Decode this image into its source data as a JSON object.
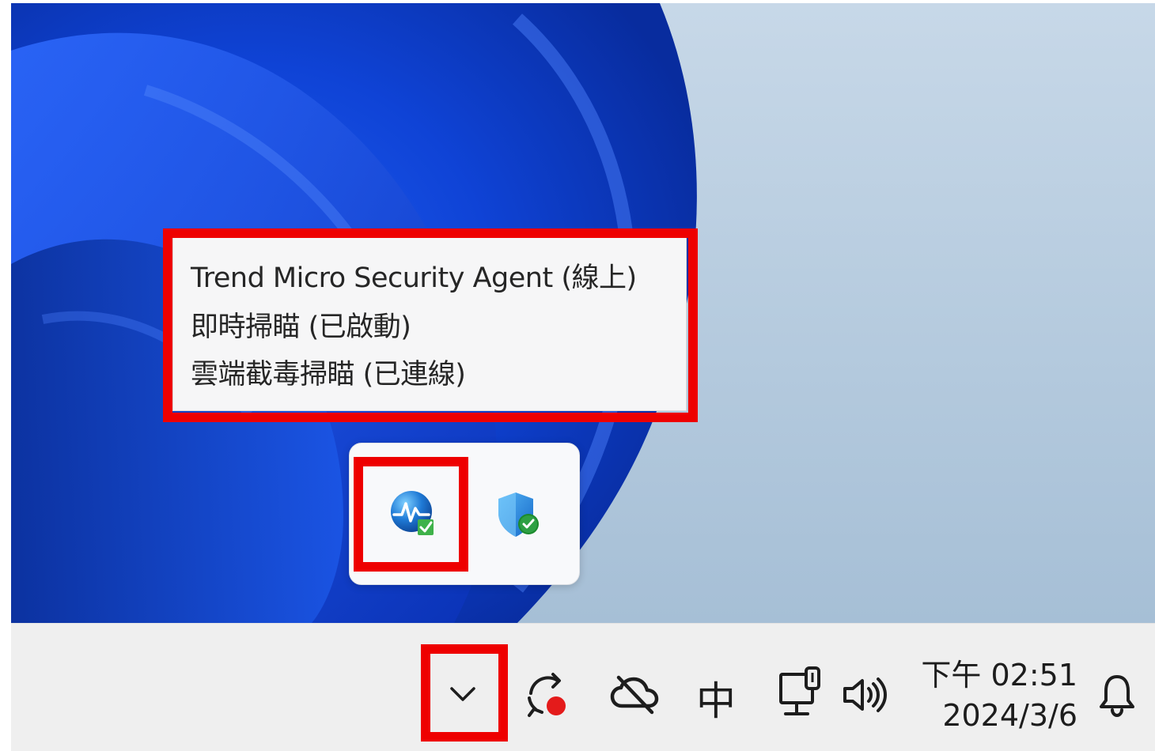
{
  "tooltip": {
    "line1": "Trend Micro Security Agent (線上)",
    "line2": "即時掃瞄 (已啟動)",
    "line3": "雲端截毒掃瞄 (已連線)"
  },
  "tray_flyout": {
    "icons": [
      "trend-micro-agent-icon",
      "windows-security-shield-icon"
    ]
  },
  "taskbar": {
    "ime_label": "中",
    "time": "下午 02:51",
    "date": "2024/3/6"
  },
  "colors": {
    "highlight": "#ee0000",
    "taskbar": "#efefef",
    "wallpaper_blue": "#0a3fd0"
  }
}
